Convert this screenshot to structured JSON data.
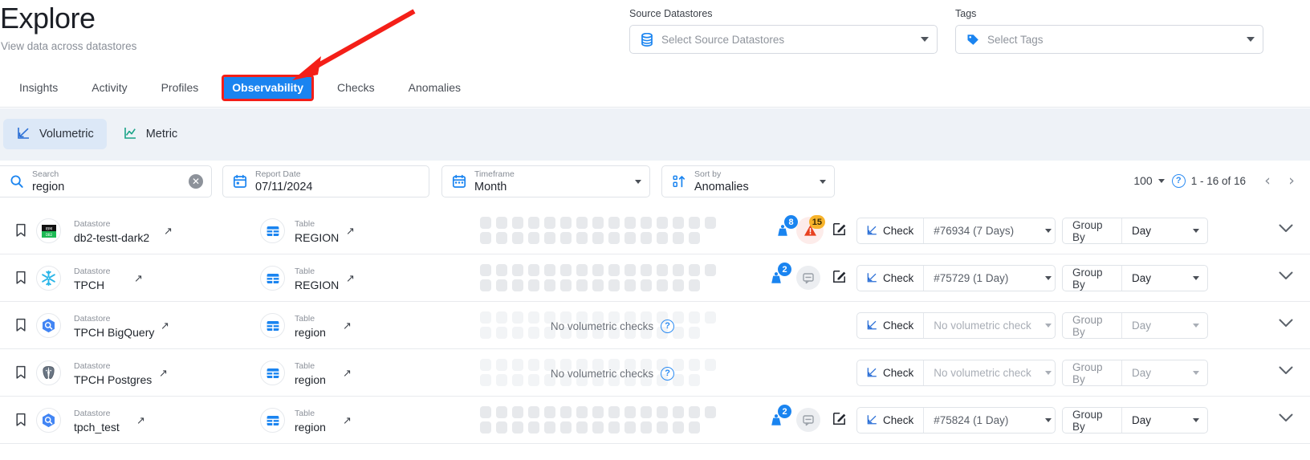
{
  "header": {
    "title": "Explore",
    "subtitle": "View data across datastores",
    "source_datastores": {
      "label": "Source Datastores",
      "placeholder": "Select Source Datastores",
      "icon": "database-icon"
    },
    "tags": {
      "label": "Tags",
      "placeholder": "Select Tags",
      "icon": "tag-icon"
    }
  },
  "tabs": [
    {
      "label": "Insights",
      "active": false
    },
    {
      "label": "Activity",
      "active": false
    },
    {
      "label": "Profiles",
      "active": false
    },
    {
      "label": "Observability",
      "active": true
    },
    {
      "label": "Checks",
      "active": false
    },
    {
      "label": "Anomalies",
      "active": false
    }
  ],
  "subtabs": [
    {
      "label": "Volumetric",
      "icon": "volumetric-chart-icon",
      "active": true
    },
    {
      "label": "Metric",
      "icon": "metric-chart-icon",
      "active": false
    }
  ],
  "toolbar": {
    "search": {
      "caption": "Search",
      "value": "region",
      "icon": "search-icon",
      "clear": "✕"
    },
    "report_date": {
      "caption": "Report Date",
      "value": "07/11/2024",
      "icon": "calendar-icon"
    },
    "timeframe": {
      "caption": "Timeframe",
      "value": "Month",
      "icon": "calendar-icon"
    },
    "sort_by": {
      "caption": "Sort by",
      "value": "Anomalies",
      "icon": "sort-numeric-icon"
    }
  },
  "pagination": {
    "page_size": "100",
    "range": "1 - 16 of 16",
    "prev": "‹",
    "next": "›",
    "help": "?"
  },
  "labels": {
    "datastore": "Datastore",
    "table": "Table",
    "check": "Check",
    "group_by": "Group By",
    "no_volumetric_checks": "No volumetric checks",
    "no_volumetric_check_option": "No volumetric check",
    "external_link": "↗"
  },
  "rows": [
    {
      "datastore": "db2-testt-dark2",
      "datastore_icon": "ibm-db2-icon",
      "table": "REGION",
      "chart_state": "skeleton",
      "weight_badge": "8",
      "anomaly_badge": "15",
      "status_icon": "warning-triangle-icon",
      "check_value": "#76934 (7 Days)",
      "check_placeholder": false,
      "group_by_value": "Day",
      "disabled": false
    },
    {
      "datastore": "TPCH",
      "datastore_icon": "snowflake-icon",
      "table": "REGION",
      "chart_state": "skeleton",
      "weight_badge": "2",
      "anomaly_badge": null,
      "status_icon": "comment-muted-icon",
      "check_value": "#75729 (1 Day)",
      "check_placeholder": false,
      "group_by_value": "Day",
      "disabled": false
    },
    {
      "datastore": "TPCH BigQuery",
      "datastore_icon": "bigquery-icon",
      "table": "region",
      "chart_state": "empty",
      "weight_badge": null,
      "anomaly_badge": null,
      "status_icon": null,
      "check_value": "No volumetric check",
      "check_placeholder": true,
      "group_by_value": "Day",
      "disabled": true
    },
    {
      "datastore": "TPCH Postgres",
      "datastore_icon": "postgresql-icon",
      "table": "region",
      "chart_state": "empty",
      "weight_badge": null,
      "anomaly_badge": null,
      "status_icon": null,
      "check_value": "No volumetric check",
      "check_placeholder": true,
      "group_by_value": "Day",
      "disabled": true
    },
    {
      "datastore": "tpch_test",
      "datastore_icon": "bigquery-icon",
      "table": "region",
      "chart_state": "skeleton",
      "weight_badge": "2",
      "anomaly_badge": null,
      "status_icon": "comment-muted-icon",
      "check_value": "#75824 (1 Day)",
      "check_placeholder": false,
      "group_by_value": "Day",
      "disabled": false
    }
  ],
  "annotation": {
    "type": "arrow",
    "color": "#f41f18",
    "points_to": "Observability"
  },
  "colors": {
    "accent": "#1a84f0",
    "highlight_outline": "#f41f18",
    "warning": "#e8411f",
    "amber": "#f7b32b",
    "subbar_bg": "#eef2f7"
  }
}
